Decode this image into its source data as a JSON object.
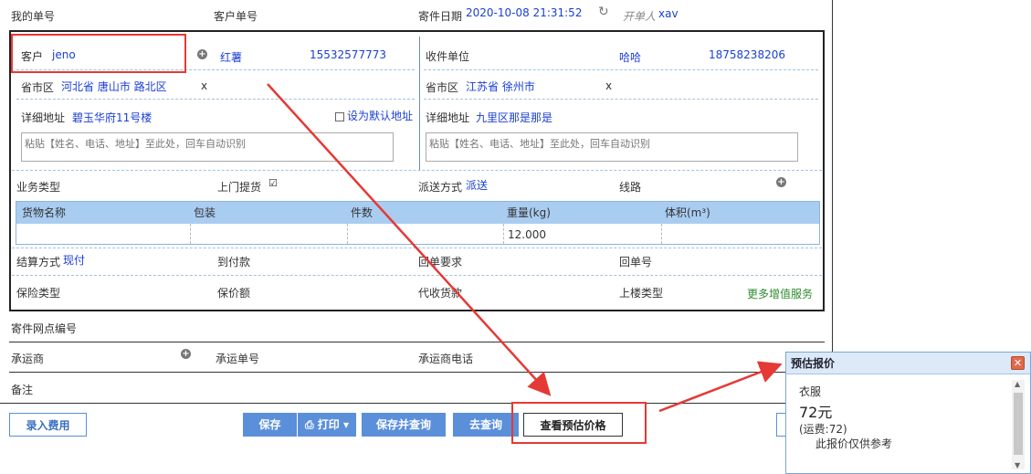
{
  "top": {
    "my_no_label": "我的单号",
    "cust_no_label": "客户单号",
    "date_label": "寄件日期",
    "date_value": "2020-10-08 21:31:52",
    "creator_label": "开单人",
    "creator_value": "xav"
  },
  "sender": {
    "customer_label": "客户",
    "customer_value": "jeno",
    "name": "红薯",
    "phone": "15532577773",
    "region_label": "省市区",
    "region_value": "河北省 唐山市 路北区",
    "clear": "x",
    "address_label": "详细地址",
    "address_value": "碧玉华府11号楼",
    "default_addr": "设为默认地址",
    "paste_placeholder": "粘贴【姓名、电话、地址】至此处，回车自动识别"
  },
  "receiver": {
    "unit_label": "收件单位",
    "name": "哈哈",
    "phone": "18758238206",
    "region_label": "省市区",
    "region_value": "江苏省 徐州市",
    "clear": "x",
    "address_label": "详细地址",
    "address_value": "九里区那是那是",
    "paste_placeholder": "粘贴【姓名、电话、地址】至此处，回车自动识别"
  },
  "business": {
    "type_label": "业务类型",
    "pickup_label": "上门提货",
    "delivery_label": "派送方式",
    "delivery_value": "派送",
    "route_label": "线路"
  },
  "goods": {
    "headers": [
      "货物名称",
      "包装",
      "件数",
      "重量(kg)",
      "体积(m³)"
    ],
    "weight_value": "12.000"
  },
  "settle": {
    "method_label": "结算方式",
    "method_value": "现付",
    "cod_label": "到付款",
    "receipt_req_label": "回单要求",
    "receipt_no_label": "回单号",
    "insure_type_label": "保险类型",
    "insure_amt_label": "保价额",
    "collect_label": "代收货款",
    "floor_label": "上楼类型",
    "more_services": "更多增值服务"
  },
  "outer": {
    "outlet_label": "寄件网点编号",
    "carrier_label": "承运商",
    "carrier_no_label": "承运单号",
    "carrier_phone_label": "承运商电话",
    "remark_label": "备注"
  },
  "buttons": {
    "record_fee": "录入费用",
    "save": "保存",
    "print": "打印",
    "save_query": "保存并查询",
    "go_query": "去查询",
    "estimate": "查看预估价格"
  },
  "popup": {
    "title": "预估报价",
    "item": "衣服",
    "price": "72元",
    "freight": "(运费:72)",
    "note": "此报价仅供参考"
  },
  "colors": {
    "accent": "#5b8fd9",
    "link": "#1a3fd6",
    "highlight": "#e53935"
  }
}
